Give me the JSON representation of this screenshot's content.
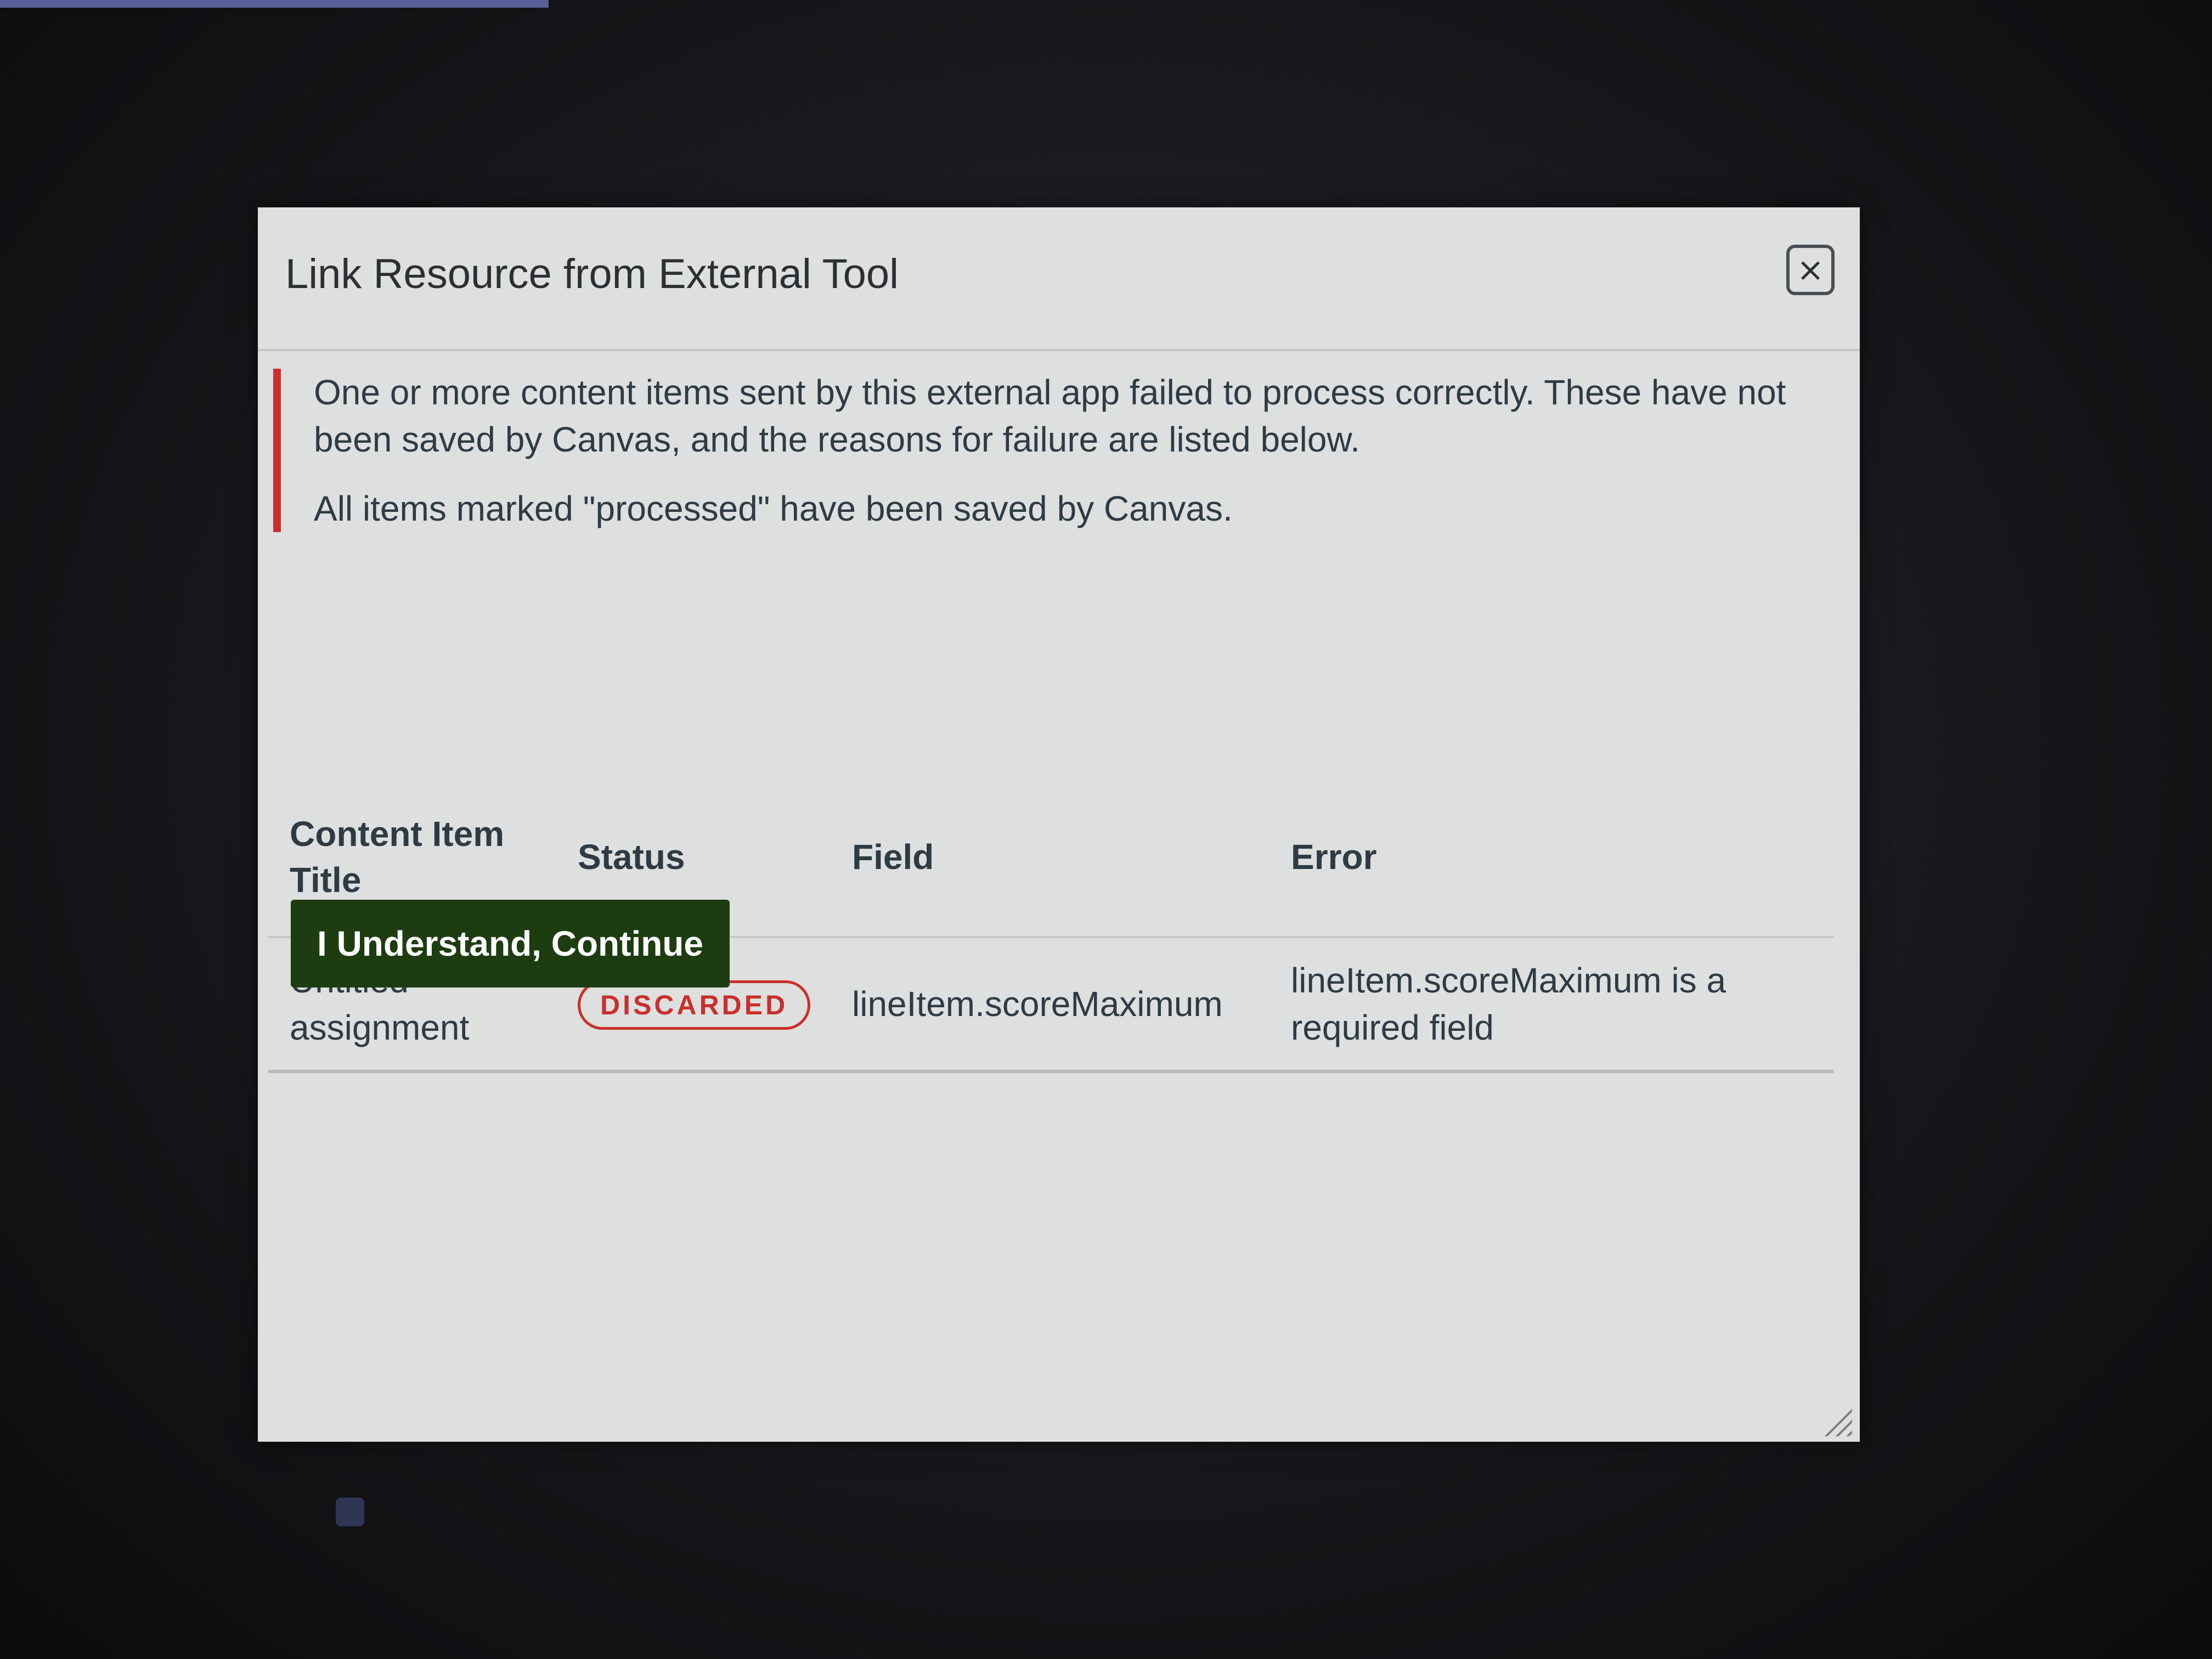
{
  "modal": {
    "title": "Link Resource from External Tool",
    "close_icon": "×",
    "alert": {
      "message": "One or more content items sent by this external app failed to process correctly. These have not been saved by Canvas, and the reasons for failure are listed below.",
      "note": "All items marked \"processed\" have been saved by Canvas."
    },
    "table": {
      "headers": [
        "Content Item Title",
        "Status",
        "Field",
        "Error"
      ],
      "rows": [
        {
          "title": "Untitled assignment",
          "status": "DISCARDED",
          "field": "lineItem.scoreMaximum",
          "error": "lineItem.scoreMaximum is a required field"
        }
      ]
    },
    "continue_label": "I Understand, Continue"
  },
  "colors": {
    "error_red": "#c9302c",
    "button_green": "#1d3d10",
    "modal_background": "#dedfdf"
  }
}
